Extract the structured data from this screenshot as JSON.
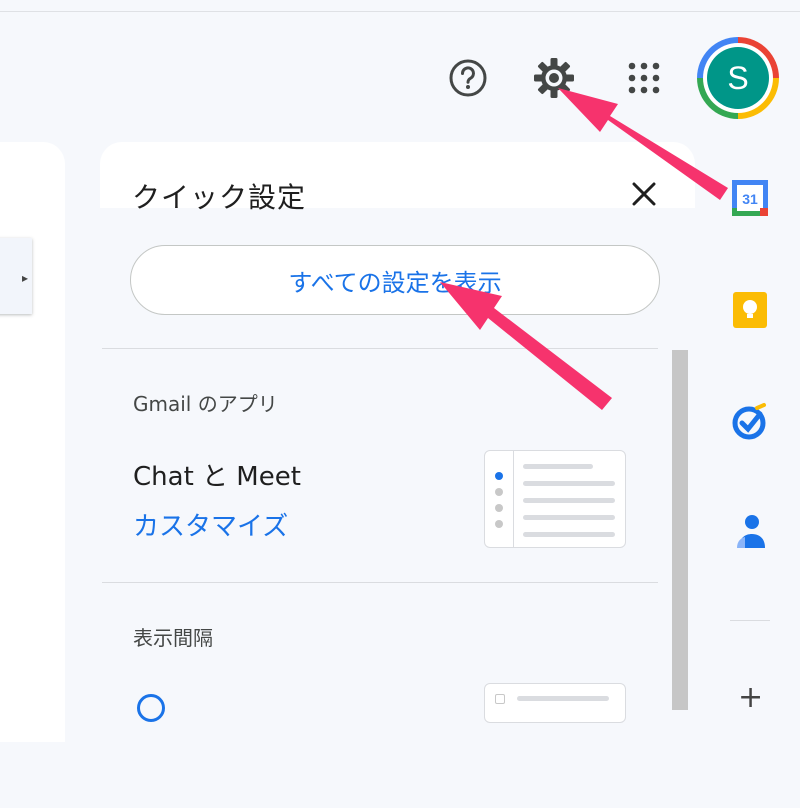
{
  "header": {
    "help_icon": "help-circle-icon",
    "settings_icon": "gear-icon",
    "apps_icon": "apps-grid-icon",
    "avatar_letter": "S"
  },
  "quick_settings": {
    "title": "クイック設定",
    "close_icon": "close-icon",
    "view_all_label": "すべての設定を表示",
    "gmail_apps": {
      "heading": "Gmail のアプリ",
      "item_label": "Chat と Meet",
      "customize_label": "カスタマイズ"
    },
    "density": {
      "heading": "表示間隔"
    }
  },
  "side_apps": [
    {
      "icon": "calendar-icon",
      "label": "31"
    },
    {
      "icon": "keep-icon"
    },
    {
      "icon": "tasks-icon"
    },
    {
      "icon": "contacts-icon"
    }
  ],
  "colors": {
    "accent": "#1a73e8",
    "arrow": "#f6336d",
    "avatar_bg": "#009688"
  }
}
